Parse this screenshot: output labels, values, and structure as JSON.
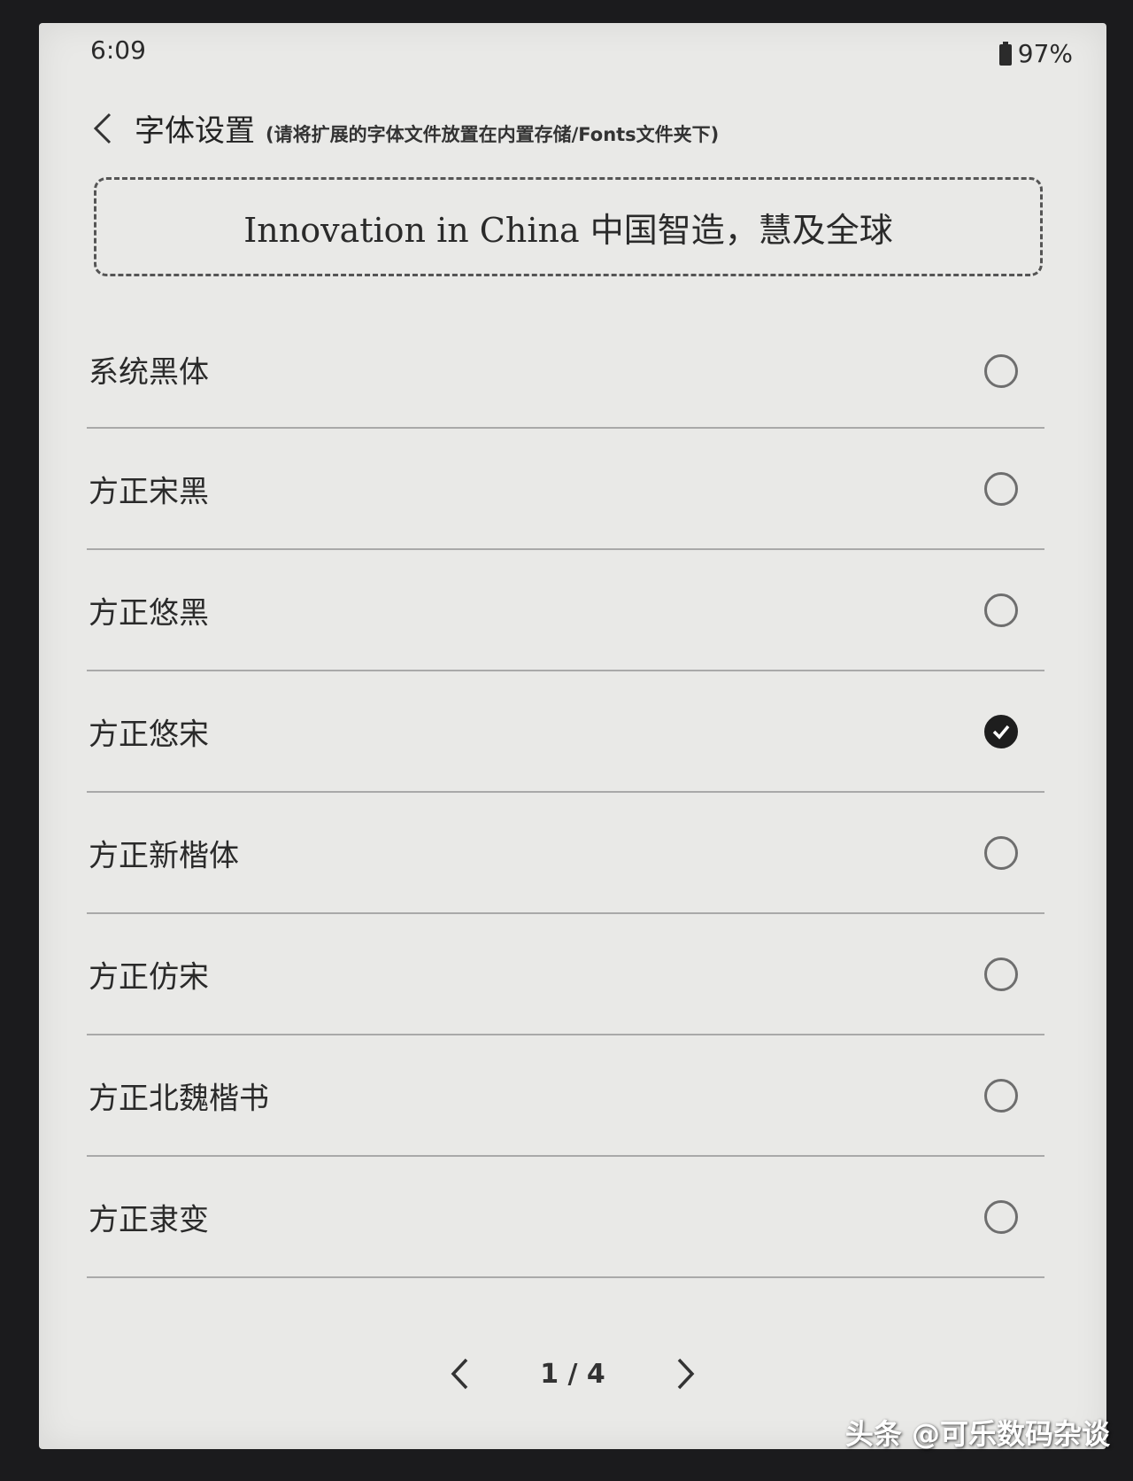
{
  "status_bar": {
    "time": "6:09",
    "battery": "97%"
  },
  "header": {
    "title": "字体设置",
    "hint": "(请将扩展的字体文件放置在内置存储/Fonts文件夹下)"
  },
  "preview": {
    "text": "Innovation in China 中国智造，慧及全球"
  },
  "fonts": [
    {
      "label": "系统黑体",
      "selected": false
    },
    {
      "label": "方正宋黑",
      "selected": false
    },
    {
      "label": "方正悠黑",
      "selected": false
    },
    {
      "label": "方正悠宋",
      "selected": true
    },
    {
      "label": "方正新楷体",
      "selected": false
    },
    {
      "label": "方正仿宋",
      "selected": false
    },
    {
      "label": "方正北魏楷书",
      "selected": false
    },
    {
      "label": "方正隶变",
      "selected": false
    }
  ],
  "pager": {
    "indicator": "1 / 4"
  },
  "watermark": "头条 @可乐数码杂谈",
  "colors": {
    "screen_bg": "#e9e9e7",
    "text": "#2a2a2a",
    "divider": "#a9a9a9",
    "checked": "#1e1e1e"
  }
}
